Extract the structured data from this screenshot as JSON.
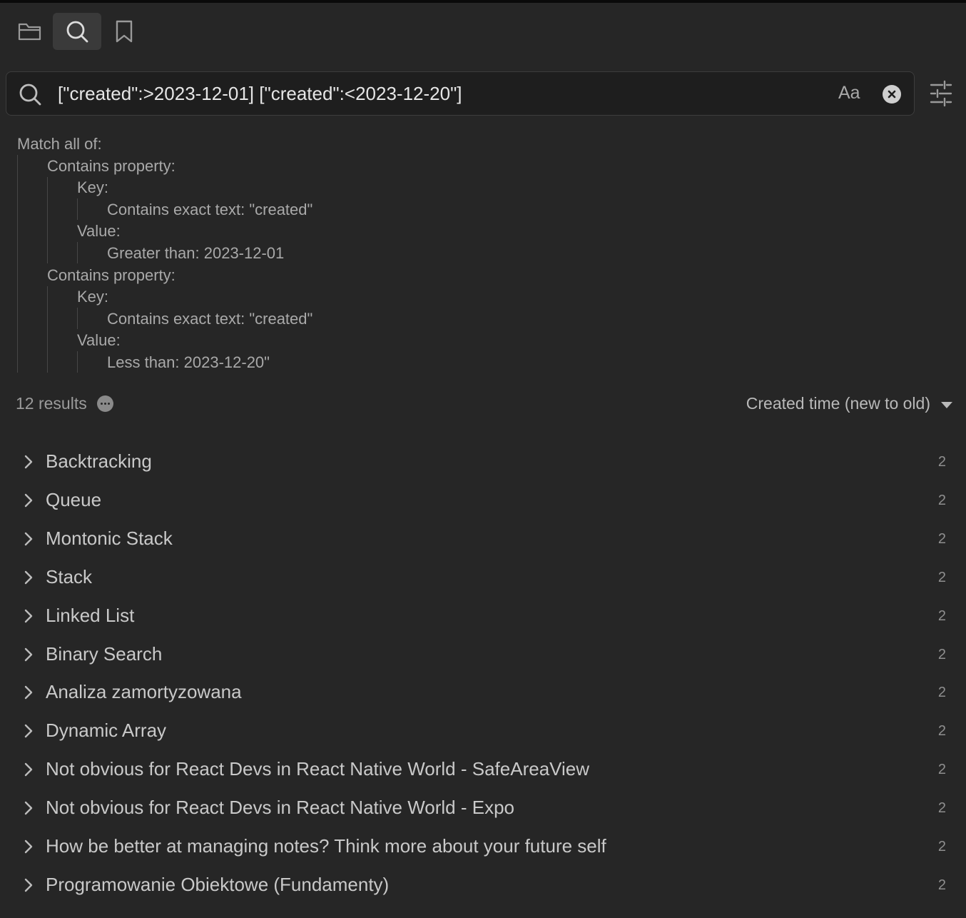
{
  "tabs": [
    {
      "name": "file-explorer",
      "icon": "folder-icon"
    },
    {
      "name": "search",
      "icon": "search-icon",
      "active": true
    },
    {
      "name": "bookmarks",
      "icon": "bookmark-icon"
    }
  ],
  "search": {
    "query": "[\"created\":>2023-12-01] [\"created\":<2023-12-20\"]",
    "match_case_label": "Aa"
  },
  "explain": {
    "match_all": "Match all of:",
    "prop1": "Contains property:",
    "prop1_key": "Key:",
    "prop1_key_text": "Contains exact text: \"created\"",
    "prop1_value": "Value:",
    "prop1_value_text": "Greater than: 2023-12-01",
    "prop2": "Contains property:",
    "prop2_key": "Key:",
    "prop2_key_text": "Contains exact text: \"created\"",
    "prop2_value": "Value:",
    "prop2_value_text": "Less than: 2023-12-20\""
  },
  "results_header": {
    "count_text": "12 results",
    "sort_label": "Created time (new to old)"
  },
  "results": [
    {
      "title": "Backtracking",
      "count": "2"
    },
    {
      "title": "Queue",
      "count": "2"
    },
    {
      "title": "Montonic Stack",
      "count": "2"
    },
    {
      "title": "Stack",
      "count": "2"
    },
    {
      "title": "Linked List",
      "count": "2"
    },
    {
      "title": "Binary Search",
      "count": "2"
    },
    {
      "title": "Analiza zamortyzowana",
      "count": "2"
    },
    {
      "title": "Dynamic Array",
      "count": "2"
    },
    {
      "title": "Not obvious for React Devs in React Native World - SafeAreaView",
      "count": "2"
    },
    {
      "title": "Not obvious for React Devs in React Native World - Expo",
      "count": "2"
    },
    {
      "title": "How be better at managing notes? Think more about your future self",
      "count": "2"
    },
    {
      "title": "Programowanie Obiektowe (Fundamenty)",
      "count": "2"
    }
  ],
  "colors": {
    "background": "#262626",
    "input_background": "#1e1e1e",
    "active_tab": "#3a3a3a"
  }
}
